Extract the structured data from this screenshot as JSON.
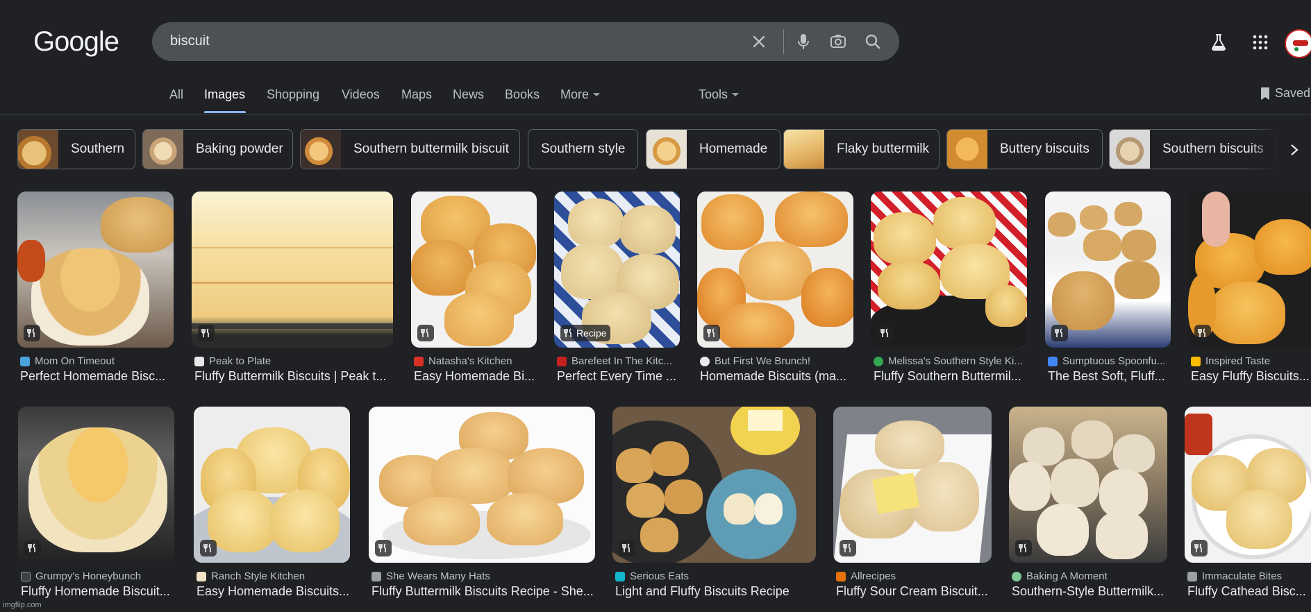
{
  "logo": "Google",
  "search": {
    "query": "biscuit"
  },
  "tabs": [
    {
      "label": "All"
    },
    {
      "label": "Images"
    },
    {
      "label": "Shopping"
    },
    {
      "label": "Videos"
    },
    {
      "label": "Maps"
    },
    {
      "label": "News"
    },
    {
      "label": "Books"
    },
    {
      "label": "More"
    }
  ],
  "tools_label": "Tools",
  "saved_label": "Saved",
  "chips": [
    {
      "label": "Southern"
    },
    {
      "label": "Baking powder"
    },
    {
      "label": "Southern buttermilk biscuit"
    },
    {
      "label": "Southern style"
    },
    {
      "label": "Homemade"
    },
    {
      "label": "Flaky buttermilk"
    },
    {
      "label": "Buttery biscuits"
    },
    {
      "label": "Southern biscuits"
    }
  ],
  "results_row1": [
    {
      "source": "Mom On Timeout",
      "title": "Perfect Homemade Bisc...",
      "badge": "",
      "fav_color": "#4aa3df"
    },
    {
      "source": "Peak to Plate",
      "title": "Fluffy Buttermilk Biscuits | Peak t...",
      "badge": "",
      "fav_color": "#e8e8e8"
    },
    {
      "source": "Natasha's Kitchen",
      "title": "Easy Homemade Bi...",
      "badge": "",
      "fav_color": "#d93025"
    },
    {
      "source": "Barefeet In The Kitc...",
      "title": "Perfect Every Time ...",
      "badge": "Recipe",
      "fav_color": "#c5221f"
    },
    {
      "source": "But First We Brunch!",
      "title": "Homemade Biscuits (ma...",
      "badge": "",
      "fav_color": "#e8eaed"
    },
    {
      "source": "Melissa's Southern Style Ki...",
      "title": "Fluffy Southern Buttermil...",
      "badge": "",
      "fav_color": "#34a853"
    },
    {
      "source": "Sumptuous Spoonfu...",
      "title": "The Best Soft, Fluff...",
      "badge": "",
      "fav_color": "#4285f4"
    },
    {
      "source": "Inspired Taste",
      "title": "Easy Fluffy Biscuits...",
      "badge": "",
      "fav_color": "#fbbc04"
    }
  ],
  "results_row2": [
    {
      "source": "Grumpy's Honeybunch",
      "title": "Fluffy Homemade Biscuit...",
      "badge": "",
      "fav_color": "#3c4043"
    },
    {
      "source": "Ranch Style Kitchen",
      "title": "Easy Homemade Biscuits...",
      "badge": "",
      "fav_color": "#f1e3c6"
    },
    {
      "source": "She Wears Many Hats",
      "title": "Fluffy Buttermilk Biscuits Recipe - She...",
      "badge": "",
      "fav_color": "#9aa0a6"
    },
    {
      "source": "Serious Eats",
      "title": "Light and Fluffy Biscuits Recipe",
      "badge": "",
      "fav_color": "#12b5cb"
    },
    {
      "source": "Allrecipes",
      "title": "Fluffy Sour Cream Biscuit...",
      "badge": "",
      "fav_color": "#e8710a"
    },
    {
      "source": "Baking A Moment",
      "title": "Southern-Style Buttermilk...",
      "badge": "",
      "fav_color": "#81c995"
    },
    {
      "source": "Immaculate Bites",
      "title": "Fluffy Cathead Bisc...",
      "badge": "",
      "fav_color": "#9aa0a6"
    }
  ],
  "watermark": "imgflip.com",
  "colors": {
    "background": "#202124",
    "searchbar": "#4d5156",
    "accent": "#8ab4f8"
  }
}
